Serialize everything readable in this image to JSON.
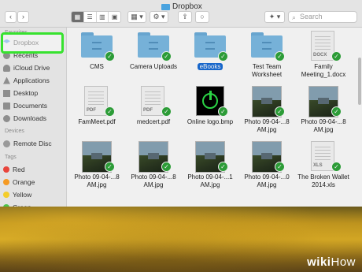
{
  "window": {
    "title": "Dropbox"
  },
  "toolbar": {
    "back": "‹",
    "forward": "›",
    "view_modes": [
      "▦",
      "☰",
      "▥",
      "▣"
    ],
    "arrange": "▦ ▾",
    "action": "⚙ ▾",
    "share": "⇪",
    "tag": "○",
    "dropbox_menu": "✦ ▾",
    "search_placeholder": "Search"
  },
  "sidebar": {
    "favorites_header": "Favorites",
    "favorites": [
      {
        "label": "Dropbox",
        "icon": "dropbox-icon"
      },
      {
        "label": "Recents",
        "icon": "clock-icon"
      },
      {
        "label": "iCloud Drive",
        "icon": "cloud-icon"
      },
      {
        "label": "Applications",
        "icon": "applications-icon"
      },
      {
        "label": "Desktop",
        "icon": "desktop-icon"
      },
      {
        "label": "Documents",
        "icon": "document-icon"
      },
      {
        "label": "Downloads",
        "icon": "download-icon"
      }
    ],
    "devices_header": "Devices",
    "devices": [
      {
        "label": "Remote Disc",
        "icon": "disc-icon"
      }
    ],
    "tags_header": "Tags",
    "tags": [
      {
        "label": "Red",
        "color": "#e8453c"
      },
      {
        "label": "Orange",
        "color": "#f59a23"
      },
      {
        "label": "Yellow",
        "color": "#f4cd2a"
      },
      {
        "label": "Green",
        "color": "#4cc44a"
      }
    ]
  },
  "files": [
    {
      "name": "CMS",
      "kind": "folder"
    },
    {
      "name": "Camera Uploads",
      "kind": "folder"
    },
    {
      "name": "eBooks",
      "kind": "folder",
      "selected": true
    },
    {
      "name": "Test Team Worksheet",
      "kind": "folder"
    },
    {
      "name": "Family Meeting_1.docx",
      "kind": "doc",
      "ext": "DOCX"
    },
    {
      "name": "FamMeet.pdf",
      "kind": "doc",
      "ext": "PDF"
    },
    {
      "name": "medcert.pdf",
      "kind": "doc",
      "ext": "PDF"
    },
    {
      "name": "Online logo.bmp",
      "kind": "logo"
    },
    {
      "name": "Photo 09-04-...8 AM.jpg",
      "kind": "photo"
    },
    {
      "name": "Photo 09-04-...8 AM.jpg",
      "kind": "photo"
    },
    {
      "name": "Photo 09-04-...8 AM.jpg",
      "kind": "photo"
    },
    {
      "name": "Photo 09-04-...8 AM.jpg",
      "kind": "photo"
    },
    {
      "name": "Photo 09-04-...1 AM.jpg",
      "kind": "photo"
    },
    {
      "name": "Photo 09-04-...0 AM.jpg",
      "kind": "photo"
    },
    {
      "name": "The Broken Wallet 2014.xls",
      "kind": "doc",
      "ext": "XLS"
    }
  ],
  "watermark": {
    "wiki": "wiki",
    "how": "How"
  }
}
